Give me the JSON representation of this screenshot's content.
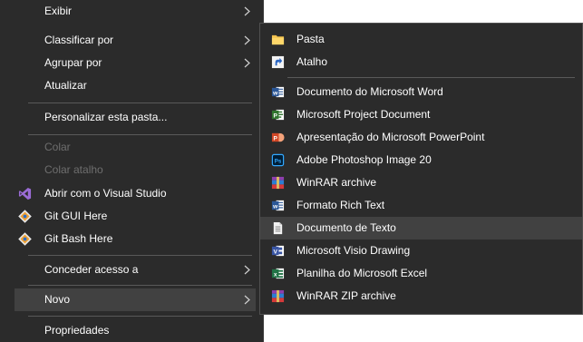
{
  "main_menu": {
    "items": [
      {
        "label": "Exibir",
        "submenu": true
      },
      {
        "label": "Classificar por",
        "submenu": true
      },
      {
        "label": "Agrupar por",
        "submenu": true
      },
      {
        "label": "Atualizar"
      },
      {
        "label": "Personalizar esta pasta..."
      },
      {
        "label": "Colar",
        "disabled": true
      },
      {
        "label": "Colar atalho",
        "disabled": true
      },
      {
        "label": "Abrir com o Visual Studio",
        "icon": "visual-studio-icon"
      },
      {
        "label": "Git GUI Here",
        "icon": "git-icon"
      },
      {
        "label": "Git Bash Here",
        "icon": "git-icon"
      },
      {
        "label": "Conceder acesso a",
        "submenu": true
      },
      {
        "label": "Novo",
        "submenu": true,
        "highlighted": true
      },
      {
        "label": "Propriedades"
      }
    ]
  },
  "new_submenu": {
    "items": [
      {
        "label": "Pasta",
        "icon": "folder-icon"
      },
      {
        "label": "Atalho",
        "icon": "shortcut-icon"
      },
      {
        "label": "Documento do Microsoft Word",
        "icon": "word-icon"
      },
      {
        "label": "Microsoft Project Document",
        "icon": "project-icon"
      },
      {
        "label": "Apresentação do Microsoft PowerPoint",
        "icon": "powerpoint-icon"
      },
      {
        "label": "Adobe Photoshop Image 20",
        "icon": "photoshop-icon"
      },
      {
        "label": "WinRAR archive",
        "icon": "winrar-icon"
      },
      {
        "label": "Formato Rich Text",
        "icon": "rtf-icon"
      },
      {
        "label": "Documento de Texto",
        "icon": "text-document-icon",
        "highlighted": true
      },
      {
        "label": "Microsoft Visio Drawing",
        "icon": "visio-icon"
      },
      {
        "label": "Planilha do Microsoft Excel",
        "icon": "excel-icon"
      },
      {
        "label": "WinRAR ZIP archive",
        "icon": "winrar-zip-icon"
      }
    ]
  },
  "colors": {
    "menu_background": "#2b2b2b",
    "highlight": "#414141",
    "separator": "#595959",
    "disabled_text": "#6e6e6e",
    "text": "#ffffff"
  }
}
